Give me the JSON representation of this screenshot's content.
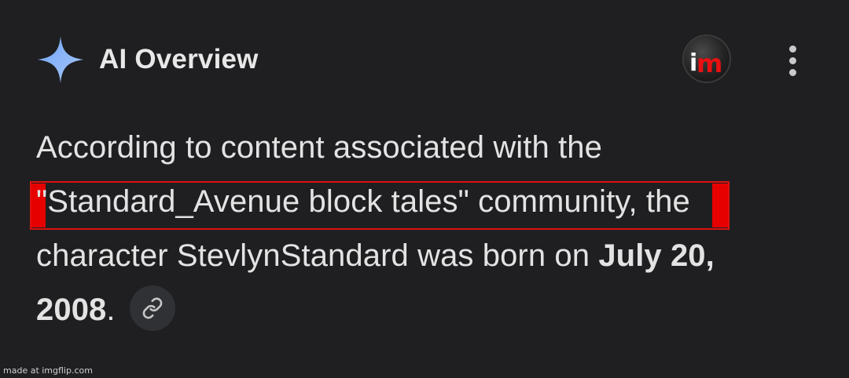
{
  "header": {
    "title": "AI Overview",
    "icon": "sparkle-icon",
    "avatar_logo": "im",
    "more_icon": "more-vert-icon"
  },
  "answer": {
    "line1": "According to content associated with the",
    "line2_highlight": "\"Standard_Avenue block tales\" community,",
    "line2_rest": " the",
    "line3_prefix": "character StevlynStandard was born on ",
    "date_part1": "July 20,",
    "date_part2": "2008",
    "period": ".",
    "link_icon": "link-icon"
  },
  "watermark": "made at imgflip.com",
  "colors": {
    "background": "#1f1f21",
    "text": "#e3e3e3",
    "highlight_border": "#e01010",
    "sparkle": "#8ab4f8"
  }
}
